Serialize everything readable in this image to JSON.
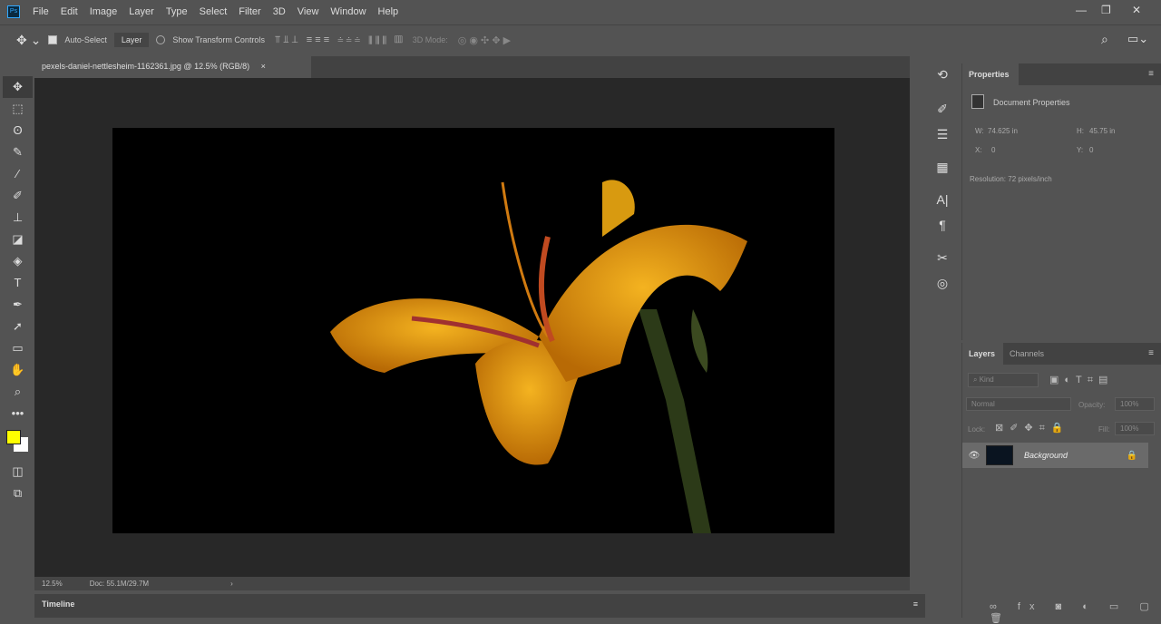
{
  "app": {
    "logo": "Ps"
  },
  "menu": [
    "File",
    "Edit",
    "Image",
    "Layer",
    "Type",
    "Select",
    "Filter",
    "3D",
    "View",
    "Window",
    "Help"
  ],
  "options": {
    "auto_select": "Auto-Select",
    "target": "Layer",
    "show_transform": "Show Transform Controls",
    "mode_3d": "3D Mode:"
  },
  "document": {
    "tab_title": "pexels-daniel-nettlesheim-1162361.jpg @ 12.5% (RGB/8)",
    "zoom": "12.5%",
    "doc_size": "Doc: 55.1M/29.7M"
  },
  "colors": {
    "foreground": "#ffff00",
    "background": "#ffffff"
  },
  "properties": {
    "tab": "Properties",
    "title": "Document Properties",
    "w_label": "W:",
    "w": "74.625 in",
    "h_label": "H:",
    "h": "45.75 in",
    "x_label": "X:",
    "x": "0",
    "y_label": "Y:",
    "y": "0",
    "resolution": "Resolution: 72 pixels/inch"
  },
  "layers": {
    "tabs": [
      "Layers",
      "Channels"
    ],
    "kind": "Kind",
    "blend": "Normal",
    "opacity_label": "Opacity:",
    "opacity": "100%",
    "lock_label": "Lock:",
    "fill_label": "Fill:",
    "fill": "100%",
    "items": [
      {
        "name": "Background"
      }
    ]
  },
  "timeline": {
    "label": "Timeline"
  }
}
